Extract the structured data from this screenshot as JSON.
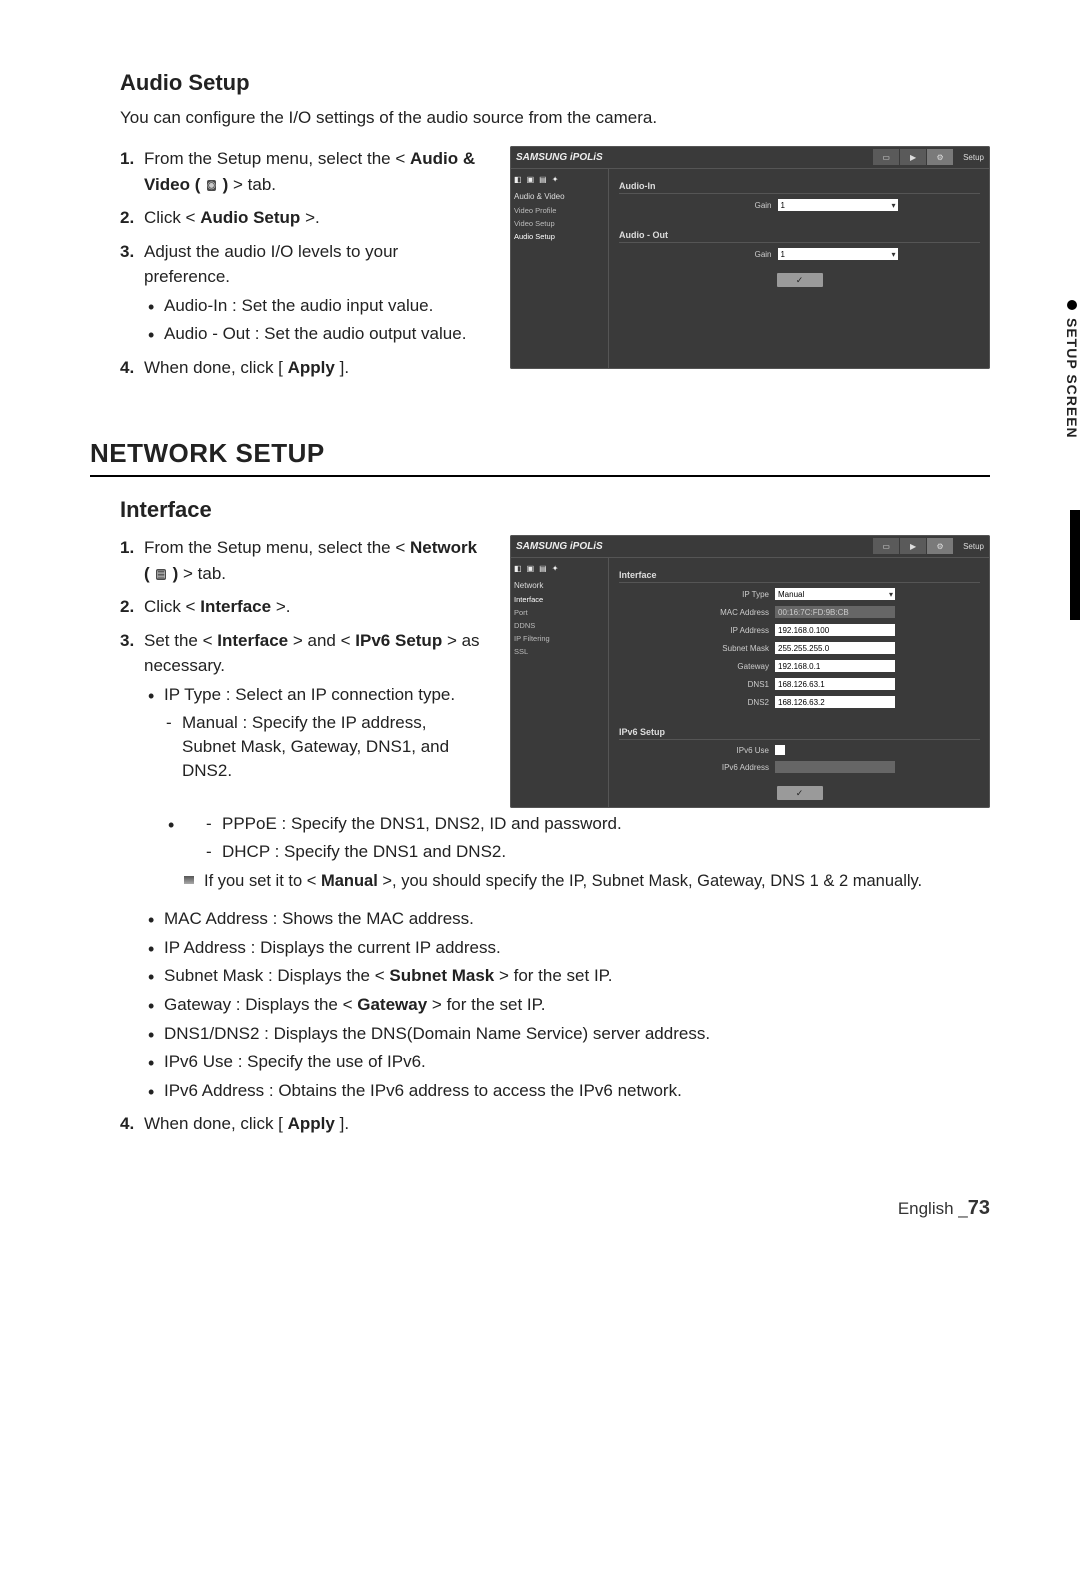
{
  "side_tab": "SETUP SCREEN",
  "audio": {
    "heading": "Audio Setup",
    "intro": "You can configure the I/O settings of the audio source from the camera.",
    "steps": {
      "s1a": "From the Setup menu, select the <",
      "s1b": "Audio & Video (",
      "s1c": " )",
      "s1d": "> tab.",
      "s2a": "Click <",
      "s2b": "Audio Setup",
      "s2c": ">.",
      "s3": "Adjust the audio I/O levels to your preference.",
      "s3_b1": "Audio-In : Set the audio input value.",
      "s3_b2": "Audio - Out : Set the audio output value.",
      "s4a": "When done, click [",
      "s4b": "Apply",
      "s4c": "]."
    }
  },
  "network_heading": "NETWORK SETUP",
  "interface": {
    "heading": "Interface",
    "steps": {
      "s1a": "From the Setup menu, select the <",
      "s1b": "Network (",
      "s1c": " )",
      "s1d": "> tab.",
      "s2a": "Click <",
      "s2b": "Interface",
      "s2c": ">.",
      "s3a": "Set the <",
      "s3b": "Interface",
      "s3c": "> and <",
      "s3d": "IPv6 Setup",
      "s3e": "> as necessary.",
      "b_iptype": "IP Type : Select an IP connection type.",
      "d_manual": "Manual : Specify the IP address, Subnet Mask, Gateway, DNS1, and DNS2.",
      "d_pppoe": "PPPoE : Specify the DNS1, DNS2, ID and password.",
      "d_dhcp": "DHCP : Specify the DNS1 and DNS2.",
      "note_a": "If you set it to <",
      "note_b": "Manual",
      "note_c": ">, you should specify the IP, Subnet Mask, Gateway, DNS 1 & 2 manually.",
      "b_mac": "MAC Address : Shows the MAC address.",
      "b_ip": "IP Address : Displays the current IP address.",
      "b_sub_a": "Subnet Mask : Displays the <",
      "b_sub_b": "Subnet Mask",
      "b_sub_c": "> for the set IP.",
      "b_gw_a": "Gateway : Displays the <",
      "b_gw_b": "Gateway",
      "b_gw_c": "> for the set IP.",
      "b_dns": "DNS1/DNS2 : Displays the DNS(Domain Name Service) server address.",
      "b_ipv6use": "IPv6 Use : Specify the use of IPv6.",
      "b_ipv6addr": "IPv6 Address : Obtains the IPv6 address to access the IPv6 network.",
      "s4a": "When done, click [",
      "s4b": "Apply",
      "s4c": "]."
    }
  },
  "ui_audio": {
    "logo": "SAMSUNG iPOLiS",
    "crumb": "Setup",
    "side_cat": "Audio & Video",
    "side_items": [
      "Video Profile",
      "Video Setup",
      "Audio Setup"
    ],
    "grp_in": "Audio-In",
    "grp_out": "Audio - Out",
    "gain_label": "Gain",
    "gain_val": "1",
    "apply": "✓"
  },
  "ui_net": {
    "logo": "SAMSUNG iPOLiS",
    "crumb": "Setup",
    "side_cat": "Network",
    "side_items": [
      "Interface",
      "Port",
      "DDNS",
      "IP Filtering",
      "SSL"
    ],
    "grp_if": "Interface",
    "grp_ipv6": "IPv6 Setup",
    "labels": {
      "iptype": "IP Type",
      "mac": "MAC Address",
      "ip": "IP Address",
      "mask": "Subnet Mask",
      "gw": "Gateway",
      "dns1": "DNS1",
      "dns2": "DNS2",
      "ipv6use": "IPv6 Use",
      "ipv6addr": "IPv6 Address"
    },
    "vals": {
      "iptype": "Manual",
      "mac": "00:16:7C:FD:9B:CB",
      "ip": "192.168.0.100",
      "mask": "255.255.255.0",
      "gw": "192.168.0.1",
      "dns1": "168.126.63.1",
      "dns2": "168.126.63.2",
      "ipv6addr": ""
    },
    "apply": "✓"
  },
  "footer": {
    "lang": "English _",
    "page": "73"
  }
}
